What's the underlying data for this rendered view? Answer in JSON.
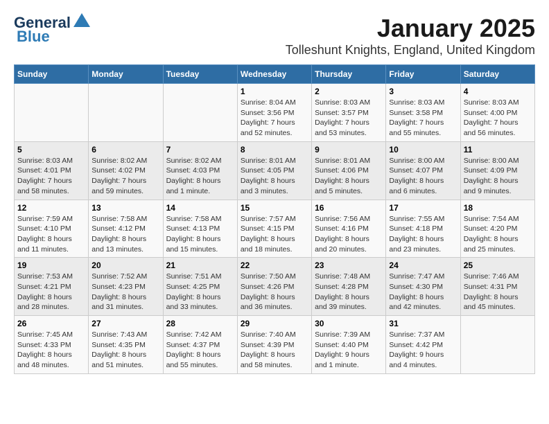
{
  "header": {
    "logo_general": "General",
    "logo_blue": "Blue",
    "title": "January 2025",
    "subtitle": "Tolleshunt Knights, England, United Kingdom"
  },
  "weekdays": [
    "Sunday",
    "Monday",
    "Tuesday",
    "Wednesday",
    "Thursday",
    "Friday",
    "Saturday"
  ],
  "weeks": [
    [
      {
        "day": "",
        "info": ""
      },
      {
        "day": "",
        "info": ""
      },
      {
        "day": "",
        "info": ""
      },
      {
        "day": "1",
        "info": "Sunrise: 8:04 AM\nSunset: 3:56 PM\nDaylight: 7 hours and 52 minutes."
      },
      {
        "day": "2",
        "info": "Sunrise: 8:03 AM\nSunset: 3:57 PM\nDaylight: 7 hours and 53 minutes."
      },
      {
        "day": "3",
        "info": "Sunrise: 8:03 AM\nSunset: 3:58 PM\nDaylight: 7 hours and 55 minutes."
      },
      {
        "day": "4",
        "info": "Sunrise: 8:03 AM\nSunset: 4:00 PM\nDaylight: 7 hours and 56 minutes."
      }
    ],
    [
      {
        "day": "5",
        "info": "Sunrise: 8:03 AM\nSunset: 4:01 PM\nDaylight: 7 hours and 58 minutes."
      },
      {
        "day": "6",
        "info": "Sunrise: 8:02 AM\nSunset: 4:02 PM\nDaylight: 7 hours and 59 minutes."
      },
      {
        "day": "7",
        "info": "Sunrise: 8:02 AM\nSunset: 4:03 PM\nDaylight: 8 hours and 1 minute."
      },
      {
        "day": "8",
        "info": "Sunrise: 8:01 AM\nSunset: 4:05 PM\nDaylight: 8 hours and 3 minutes."
      },
      {
        "day": "9",
        "info": "Sunrise: 8:01 AM\nSunset: 4:06 PM\nDaylight: 8 hours and 5 minutes."
      },
      {
        "day": "10",
        "info": "Sunrise: 8:00 AM\nSunset: 4:07 PM\nDaylight: 8 hours and 6 minutes."
      },
      {
        "day": "11",
        "info": "Sunrise: 8:00 AM\nSunset: 4:09 PM\nDaylight: 8 hours and 9 minutes."
      }
    ],
    [
      {
        "day": "12",
        "info": "Sunrise: 7:59 AM\nSunset: 4:10 PM\nDaylight: 8 hours and 11 minutes."
      },
      {
        "day": "13",
        "info": "Sunrise: 7:58 AM\nSunset: 4:12 PM\nDaylight: 8 hours and 13 minutes."
      },
      {
        "day": "14",
        "info": "Sunrise: 7:58 AM\nSunset: 4:13 PM\nDaylight: 8 hours and 15 minutes."
      },
      {
        "day": "15",
        "info": "Sunrise: 7:57 AM\nSunset: 4:15 PM\nDaylight: 8 hours and 18 minutes."
      },
      {
        "day": "16",
        "info": "Sunrise: 7:56 AM\nSunset: 4:16 PM\nDaylight: 8 hours and 20 minutes."
      },
      {
        "day": "17",
        "info": "Sunrise: 7:55 AM\nSunset: 4:18 PM\nDaylight: 8 hours and 23 minutes."
      },
      {
        "day": "18",
        "info": "Sunrise: 7:54 AM\nSunset: 4:20 PM\nDaylight: 8 hours and 25 minutes."
      }
    ],
    [
      {
        "day": "19",
        "info": "Sunrise: 7:53 AM\nSunset: 4:21 PM\nDaylight: 8 hours and 28 minutes."
      },
      {
        "day": "20",
        "info": "Sunrise: 7:52 AM\nSunset: 4:23 PM\nDaylight: 8 hours and 31 minutes."
      },
      {
        "day": "21",
        "info": "Sunrise: 7:51 AM\nSunset: 4:25 PM\nDaylight: 8 hours and 33 minutes."
      },
      {
        "day": "22",
        "info": "Sunrise: 7:50 AM\nSunset: 4:26 PM\nDaylight: 8 hours and 36 minutes."
      },
      {
        "day": "23",
        "info": "Sunrise: 7:48 AM\nSunset: 4:28 PM\nDaylight: 8 hours and 39 minutes."
      },
      {
        "day": "24",
        "info": "Sunrise: 7:47 AM\nSunset: 4:30 PM\nDaylight: 8 hours and 42 minutes."
      },
      {
        "day": "25",
        "info": "Sunrise: 7:46 AM\nSunset: 4:31 PM\nDaylight: 8 hours and 45 minutes."
      }
    ],
    [
      {
        "day": "26",
        "info": "Sunrise: 7:45 AM\nSunset: 4:33 PM\nDaylight: 8 hours and 48 minutes."
      },
      {
        "day": "27",
        "info": "Sunrise: 7:43 AM\nSunset: 4:35 PM\nDaylight: 8 hours and 51 minutes."
      },
      {
        "day": "28",
        "info": "Sunrise: 7:42 AM\nSunset: 4:37 PM\nDaylight: 8 hours and 55 minutes."
      },
      {
        "day": "29",
        "info": "Sunrise: 7:40 AM\nSunset: 4:39 PM\nDaylight: 8 hours and 58 minutes."
      },
      {
        "day": "30",
        "info": "Sunrise: 7:39 AM\nSunset: 4:40 PM\nDaylight: 9 hours and 1 minute."
      },
      {
        "day": "31",
        "info": "Sunrise: 7:37 AM\nSunset: 4:42 PM\nDaylight: 9 hours and 4 minutes."
      },
      {
        "day": "",
        "info": ""
      }
    ]
  ]
}
